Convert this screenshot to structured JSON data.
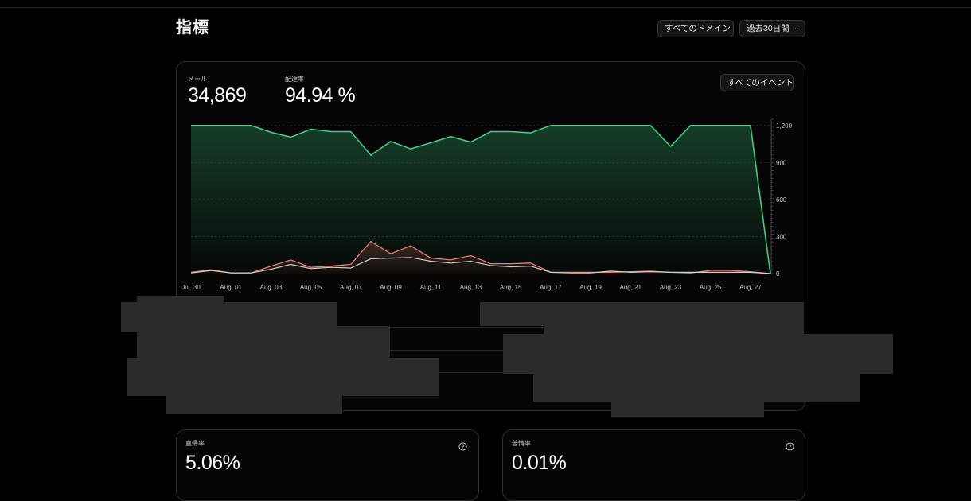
{
  "page": {
    "title": "指標"
  },
  "filters": {
    "domain_label": "すべてのドメイン",
    "period_label": "過去30日間"
  },
  "main_card": {
    "event_filter_label": "すべてのイベント",
    "metrics": [
      {
        "label": "メール",
        "value": "34,869"
      },
      {
        "label": "配達率",
        "value": "94.94 %"
      }
    ]
  },
  "bottom_cards": [
    {
      "label": "直帰率",
      "value": "5.06%"
    },
    {
      "label": "苦情率",
      "value": "0.01%"
    }
  ],
  "colors": {
    "delivered": "#3ecf82",
    "bounced": "#f07a6c",
    "other": "#cfcfcf",
    "background": "#000000"
  },
  "icons": {
    "chevron": "chevron-down-icon",
    "help": "help-circle-icon"
  },
  "chart_data": {
    "type": "area",
    "x_ticks": [
      "Jul, 30",
      "Aug, 01",
      "Aug, 03",
      "Aug, 05",
      "Aug, 07",
      "Aug, 09",
      "Aug, 11",
      "Aug, 13",
      "Aug, 15",
      "Aug, 17",
      "Aug, 19",
      "Aug, 21",
      "Aug, 23",
      "Aug, 25",
      "Aug, 27"
    ],
    "y_ticks": [
      0,
      300,
      600,
      900,
      1200
    ],
    "ylim": [
      0,
      1250
    ],
    "grid": true,
    "y_axis_side": "right",
    "series": [
      {
        "color_key": "delivered",
        "values": [
          1200,
          1200,
          1200,
          1200,
          1145,
          1105,
          1170,
          1150,
          1150,
          960,
          1070,
          1010,
          1060,
          1110,
          1065,
          1150,
          1150,
          1140,
          1200,
          1200,
          1200,
          1200,
          1200,
          1200,
          1030,
          1200,
          1200,
          1200,
          1200,
          0
        ]
      },
      {
        "color_key": "bounced",
        "values": [
          10,
          30,
          5,
          5,
          60,
          110,
          50,
          60,
          75,
          260,
          160,
          225,
          125,
          110,
          145,
          80,
          80,
          85,
          10,
          10,
          10,
          10,
          15,
          20,
          10,
          5,
          25,
          25,
          15,
          0
        ]
      },
      {
        "color_key": "other",
        "values": [
          5,
          25,
          5,
          5,
          35,
          75,
          40,
          50,
          45,
          120,
          125,
          130,
          100,
          85,
          100,
          65,
          55,
          60,
          10,
          5,
          5,
          20,
          10,
          15,
          10,
          10,
          10,
          10,
          10,
          0
        ]
      }
    ]
  }
}
